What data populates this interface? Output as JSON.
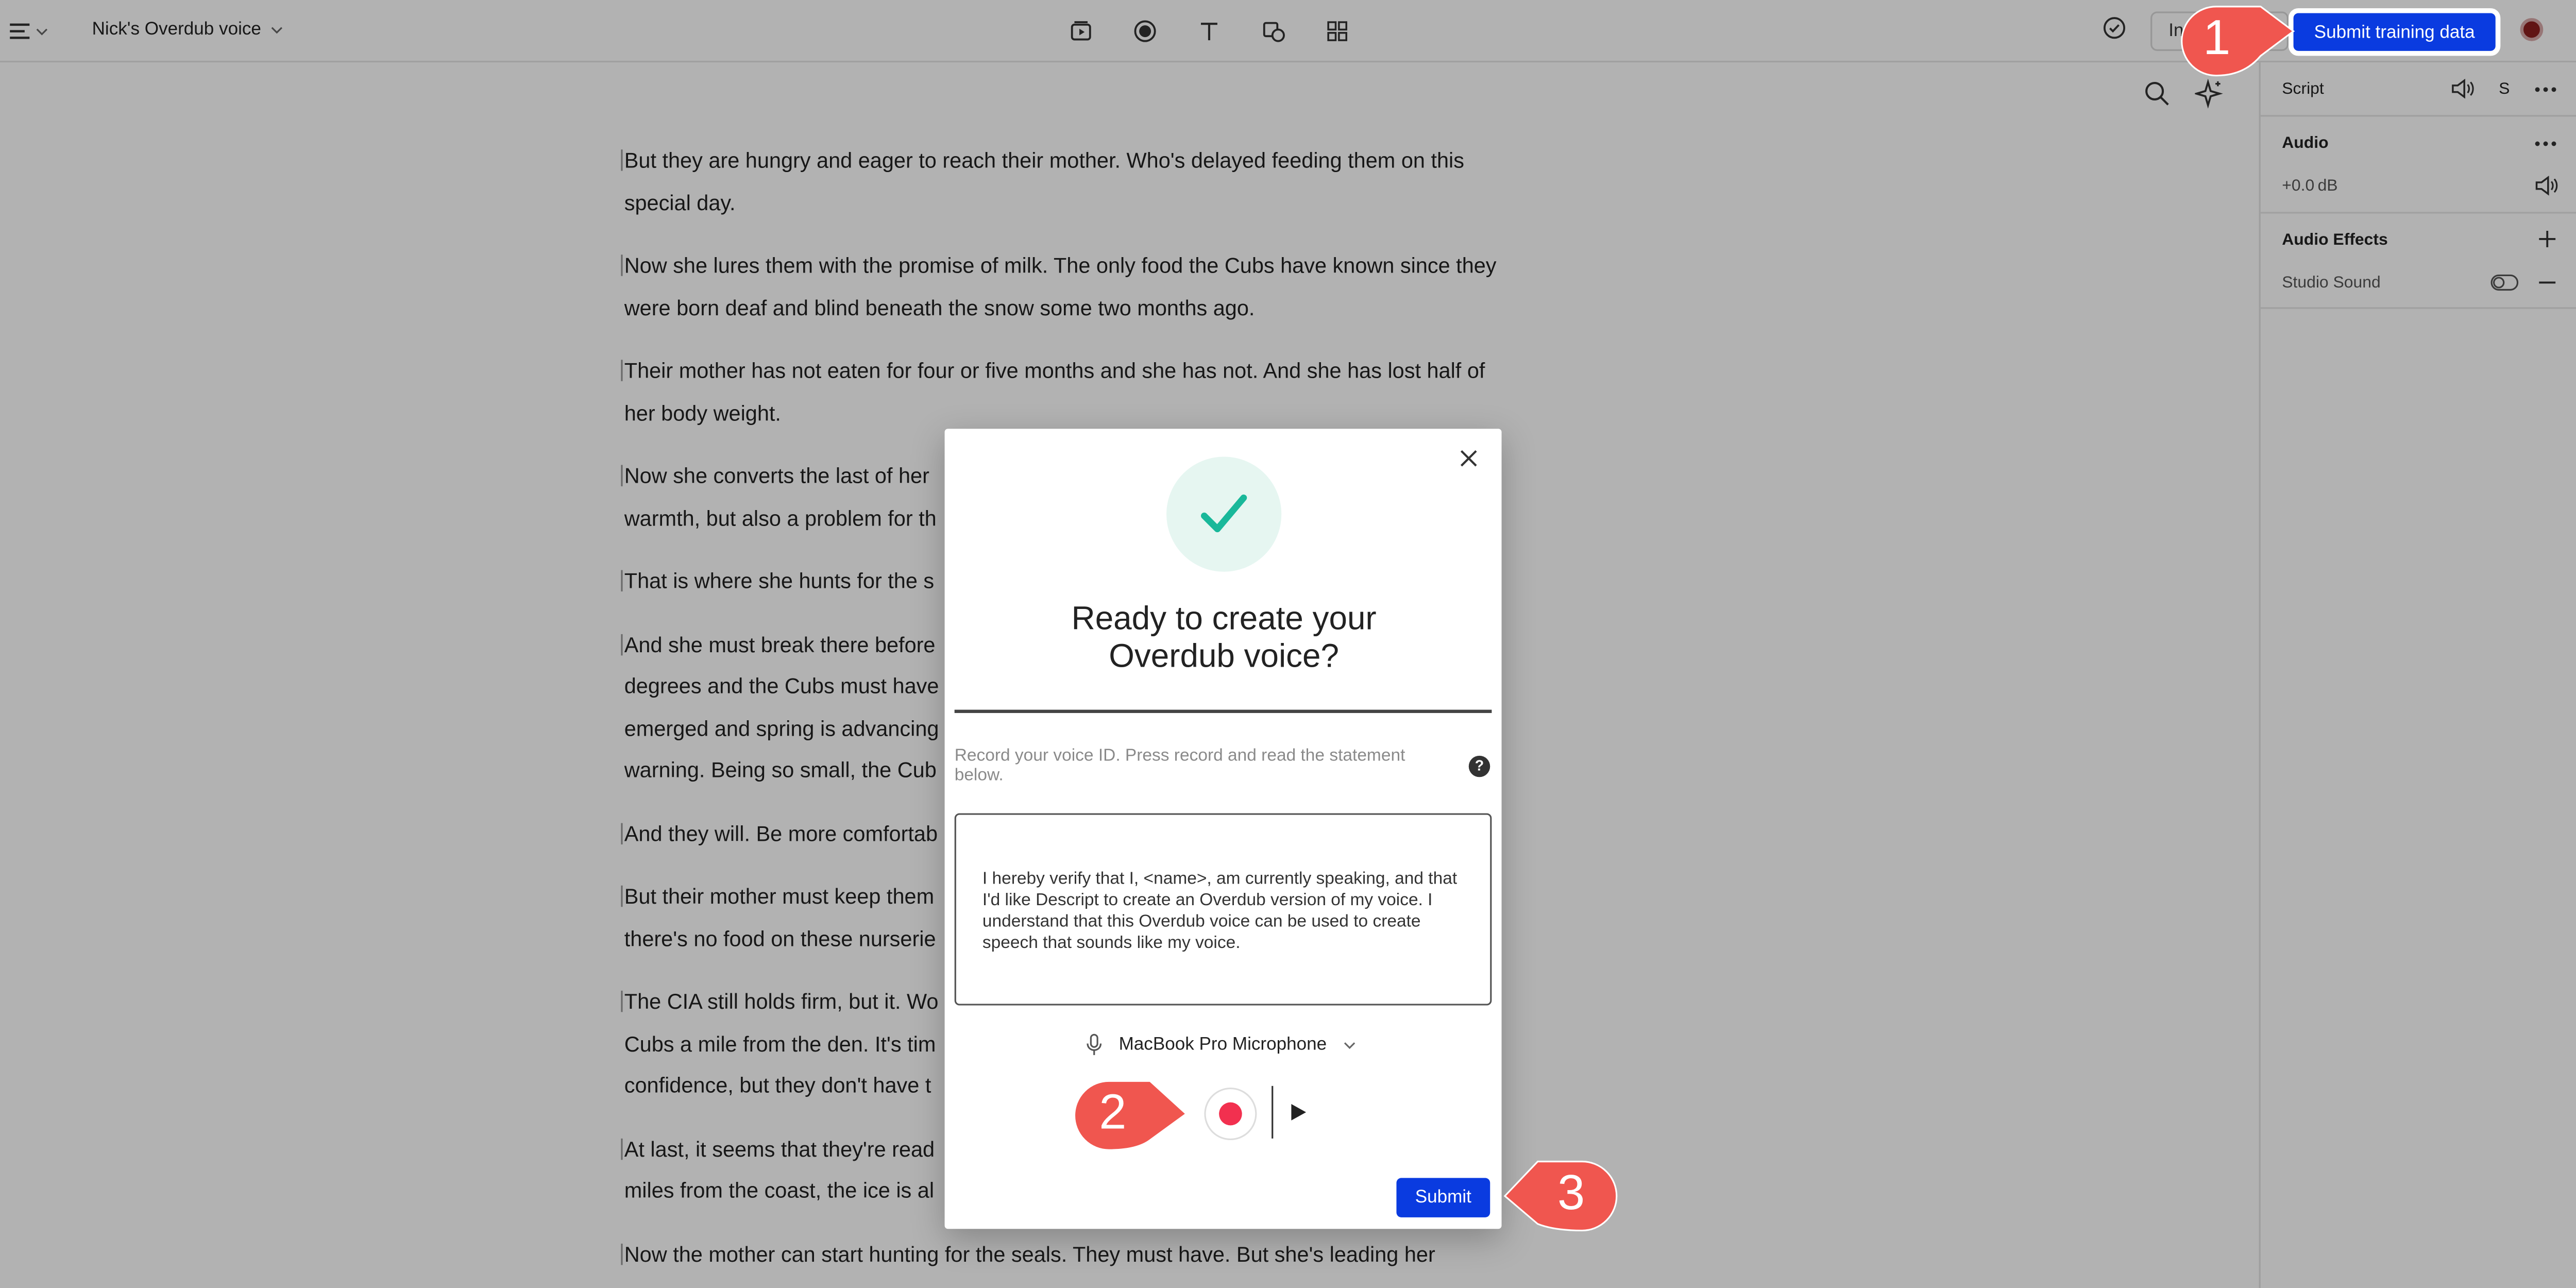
{
  "app": {
    "doc_title": "Nick's Overdub voice",
    "invite_label": "Invite",
    "submit_training_label": "Submit training data"
  },
  "transcript": {
    "paragraphs": [
      "But they are hungry and eager to reach their mother. Who's delayed feeding them on this special day.",
      "Now she lures them with the promise of milk. The only food the Cubs have known since they were born deaf and blind beneath the snow some two months ago.",
      "Their mother has not eaten for four or five months and she has not. And she has lost half of her body weight.",
      "Now she converts the last of her",
      "warmth, but also a problem for th",
      "That is where she hunts for the s",
      "And she must break there before",
      "degrees and the Cubs must have",
      "emerged and spring is advancing",
      "warning. Being so small, the Cub",
      "And they will. Be more comfortab",
      "But their mother must keep them",
      "there's no food on these nurserie",
      "The CIA still holds firm, but it. Wo",
      "Cubs a mile from the den. It's tim",
      "confidence, but they don't have t",
      "At last, it seems that they're read",
      "miles from the coast, the ice is al",
      "Now the mother can start hunting for the seals. They must have. But she's leading her"
    ]
  },
  "panel": {
    "script_label": "Script",
    "script_letter": "S",
    "audio_label": "Audio",
    "audio_gain": "+0.0 dB",
    "effects_label": "Audio Effects",
    "studio_sound_label": "Studio Sound"
  },
  "modal": {
    "title": "Ready to create your Overdub voice?",
    "instruction": "Record your voice ID. Press record and read the statement below.",
    "help_glyph": "?",
    "statement": "I hereby verify that I, <name>, am currently speaking, and that I'd like Descript to create an Overdub version of my voice. I understand that this Overdub voice can be used to create speech that sounds like my voice.",
    "microphone": "MacBook Pro Microphone",
    "submit_label": "Submit"
  },
  "callouts": [
    "1",
    "2",
    "3"
  ],
  "colors": {
    "accent_blue": "#0a3be0",
    "callout_red": "#f0564f",
    "record_red": "#f2304f",
    "check_teal": "#19b89a"
  },
  "icons": [
    "menu-icon",
    "chevron-down-icon",
    "video-icon",
    "record-icon",
    "text-icon",
    "shapes-icon",
    "grid-icon",
    "check-circle-icon",
    "search-icon",
    "sparkle-icon",
    "speaker-icon",
    "more-icon",
    "plus-icon",
    "toggle-icon",
    "minus-icon",
    "close-icon",
    "checkmark-icon",
    "microphone-icon",
    "play-icon"
  ]
}
